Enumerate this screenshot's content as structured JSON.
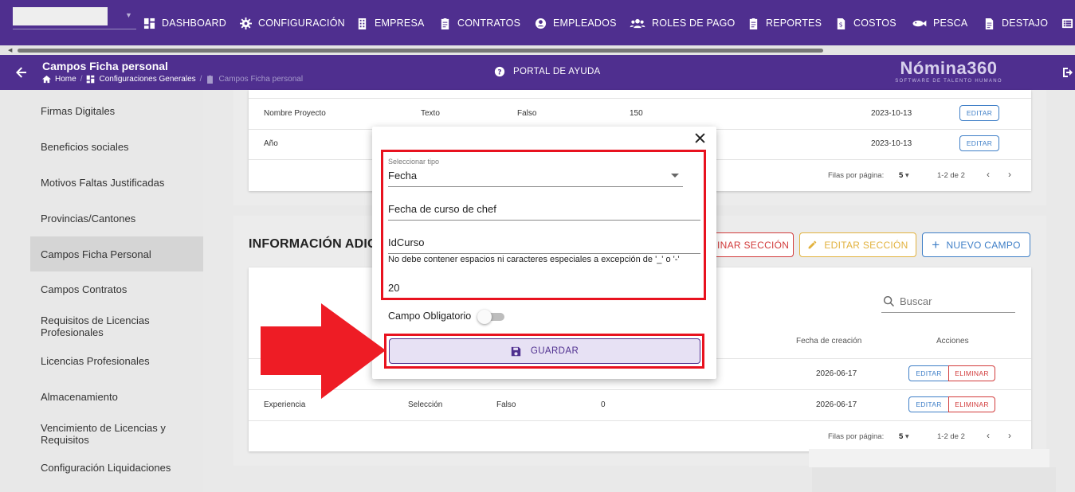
{
  "nav": {
    "items": [
      {
        "label": "DASHBOARD",
        "icon": "dashboard-icon"
      },
      {
        "label": "CONFIGURACIÓN",
        "icon": "gear-icon"
      },
      {
        "label": "EMPRESA",
        "icon": "building-icon"
      },
      {
        "label": "CONTRATOS",
        "icon": "clipboard-icon"
      },
      {
        "label": "EMPLEADOS",
        "icon": "employee-icon"
      },
      {
        "label": "ROLES DE PAGO",
        "icon": "group-icon"
      },
      {
        "label": "REPORTES",
        "icon": "clipboard-icon"
      },
      {
        "label": "COSTOS",
        "icon": "invoice-icon"
      },
      {
        "label": "PESCA",
        "icon": "fish-icon"
      },
      {
        "label": "DESTAJO",
        "icon": "document-icon"
      }
    ]
  },
  "header": {
    "title": "Campos Ficha personal",
    "breadcrumb": [
      "Home",
      "Configuraciones Generales",
      "Campos Ficha personal"
    ],
    "help_label": "PORTAL DE AYUDA",
    "logo_main": "Nómina360",
    "logo_sub": "SOFTWARE DE TALENTO HUMANO"
  },
  "sidebar": {
    "items": [
      {
        "label": "Firmas Digitales"
      },
      {
        "label": "Beneficios sociales"
      },
      {
        "label": "Motivos Faltas Justificadas"
      },
      {
        "label": "Provincias/Cantones"
      },
      {
        "label": "Campos Ficha Personal"
      },
      {
        "label": "Campos Contratos"
      },
      {
        "label": "Requisitos de Licencias Profesionales"
      },
      {
        "label": "Licencias Profesionales"
      },
      {
        "label": "Almacenamiento"
      },
      {
        "label": "Vencimiento de Licencias y Requisitos"
      },
      {
        "label": "Configuración Liquidaciones"
      }
    ]
  },
  "top_table": {
    "rows": [
      {
        "nombre": "Nombre Proyecto",
        "tipo": "Texto",
        "obligatorio": "Falso",
        "longitud": "150",
        "fecha": "2023-10-13",
        "edit": "EDITAR"
      },
      {
        "nombre": "Año",
        "tipo": "",
        "obligatorio": "",
        "longitud": "",
        "fecha": "2023-10-13",
        "edit": "EDITAR"
      }
    ],
    "pager_label": "Filas por página:",
    "pager_size": "5",
    "pager_range": "1-2 de 2"
  },
  "section": {
    "title": "INFORMACIÓN ADIC",
    "delete_label": "MINAR SECCIÓN",
    "edit_label": "EDITAR SECCIÓN",
    "new_label": "NUEVO CAMPO",
    "search_placeholder": "Buscar",
    "col_fecha": "Fecha de creación",
    "col_acciones": "Acciones",
    "rows": [
      {
        "nombre": "",
        "tipo": "",
        "obligatorio": "",
        "longitud": "",
        "fecha": "2026-06-17",
        "edit": "EDITAR",
        "delete": "ELIMINAR"
      },
      {
        "nombre": "Experiencia",
        "tipo": "Selección",
        "obligatorio": "Falso",
        "longitud": "0",
        "fecha": "2026-06-17",
        "edit": "EDITAR",
        "delete": "ELIMINAR"
      }
    ],
    "pager_label": "Filas por página:",
    "pager_size": "5",
    "pager_range": "1-2 de 2"
  },
  "modal": {
    "type_label": "Seleccionar tipo",
    "type_value": "Fecha",
    "name_value": "Fecha de curso de chef",
    "id_value": "IdCurso",
    "id_hint": "No debe contener espacios ni caracteres especiales a excepción de '_' o '-'",
    "length_value": "20",
    "required_label": "Campo Obligatorio",
    "save_label": "GUARDAR"
  },
  "colors": {
    "brand": "#4f2f8f",
    "highlight": "#e8121f",
    "edit": "#3f7fc7",
    "delete": "#d23b3b",
    "edit_section": "#e2b23e"
  }
}
